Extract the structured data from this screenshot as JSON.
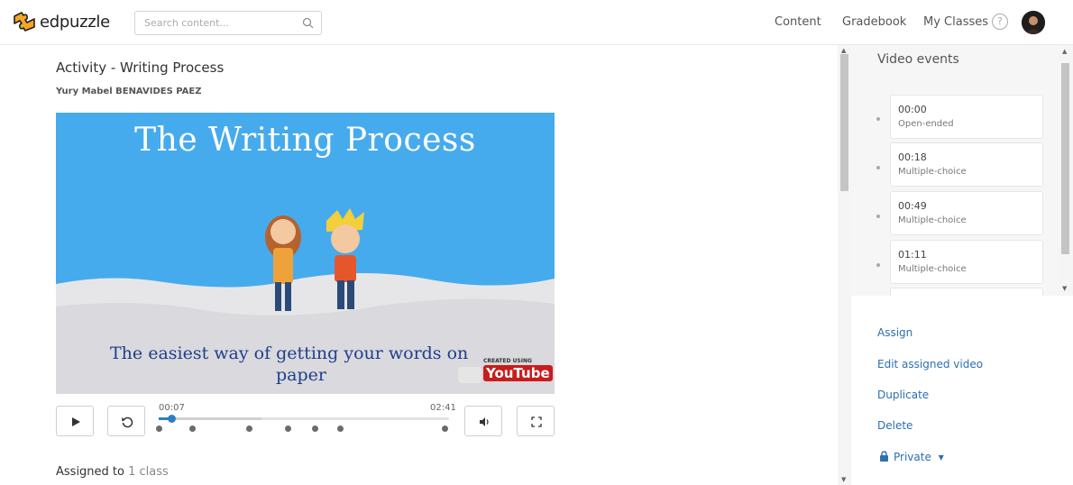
{
  "header": {
    "logo_text": "edpuzzle",
    "search_placeholder": "Search content...",
    "nav": [
      "Content",
      "Gradebook",
      "My Classes"
    ],
    "help_label": "?"
  },
  "activity": {
    "title": "Activity - Writing Process",
    "author": "Yury Mabel BENAVIDES PAEZ"
  },
  "video": {
    "heading": "The Writing Process",
    "subtitle_line1": "The easiest way of getting your words on",
    "subtitle_line2": "paper",
    "badge_top": "CREATED USING",
    "badge_brand": "YouTube",
    "current_time": "00:07",
    "duration": "02:41",
    "progress_fraction": 0.04
  },
  "assigned": {
    "prefix": "Assigned to",
    "link": "1 class"
  },
  "events": {
    "title": "Video events",
    "items": [
      {
        "time": "00:00",
        "type": "Open-ended"
      },
      {
        "time": "00:18",
        "type": "Multiple-choice"
      },
      {
        "time": "00:49",
        "type": "Multiple-choice"
      },
      {
        "time": "01:11",
        "type": "Multiple-choice"
      }
    ]
  },
  "actions": {
    "assign": "Assign",
    "edit": "Edit assigned video",
    "duplicate": "Duplicate",
    "delete": "Delete",
    "privacy": "Private"
  },
  "colors": {
    "accent": "#2c6fb3",
    "progress": "#2c7ec4",
    "logo": "#f5a623",
    "video_sky": "#3ea6ec"
  }
}
